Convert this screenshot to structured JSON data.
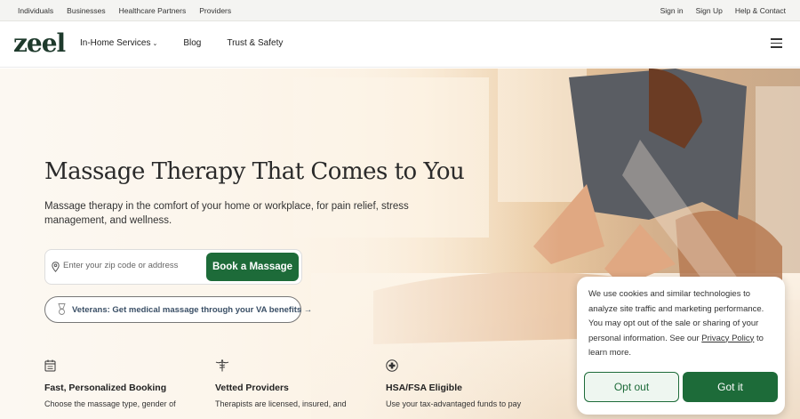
{
  "topbar": {
    "left_links": [
      "Individuals",
      "Businesses",
      "Healthcare Partners",
      "Providers"
    ],
    "right_links": [
      "Sign in",
      "Sign Up",
      "Help & Contact"
    ]
  },
  "nav": {
    "logo": "zeel",
    "links": [
      "In-Home Services",
      "Blog",
      "Trust & Safety"
    ],
    "dropdown_icon": "chevron-down-icon",
    "menu_icon": "hamburger-menu-icon"
  },
  "hero": {
    "title": "Massage Therapy That Comes to You",
    "subtitle": "Massage therapy in the comfort of your home or workplace, for pain relief, stress management, and wellness.",
    "search": {
      "placeholder": "Enter your zip code or address",
      "icon": "location-pin-icon"
    },
    "book_button": "Book a Massage",
    "veterans": {
      "label": "Veterans: Get medical massage through your VA benefits",
      "arrow": "→",
      "icon": "medal-icon"
    }
  },
  "features": [
    {
      "icon": "calendar-icon",
      "title": "Fast, Personalized Booking",
      "desc": "Choose the massage type, gender of"
    },
    {
      "icon": "caduceus-icon",
      "title": "Vetted Providers",
      "desc": "Therapists are licensed, insured, and"
    },
    {
      "icon": "medical-cross-icon",
      "title": "HSA/FSA Eligible",
      "desc": "Use your tax-advantaged funds to pay"
    }
  ],
  "cookie": {
    "text_before_link": "We use cookies and similar technologies to analyze site traffic and marketing performance. You may opt out of the sale or sharing of your personal information. See our ",
    "link": "Privacy Policy",
    "text_after_link": " to learn more.",
    "opt_out": "Opt out",
    "got_it": "Got it"
  },
  "colors": {
    "brand_green": "#1d6b39",
    "logo_green": "#1e3a2c",
    "veteran_blue": "#3a4f66"
  }
}
